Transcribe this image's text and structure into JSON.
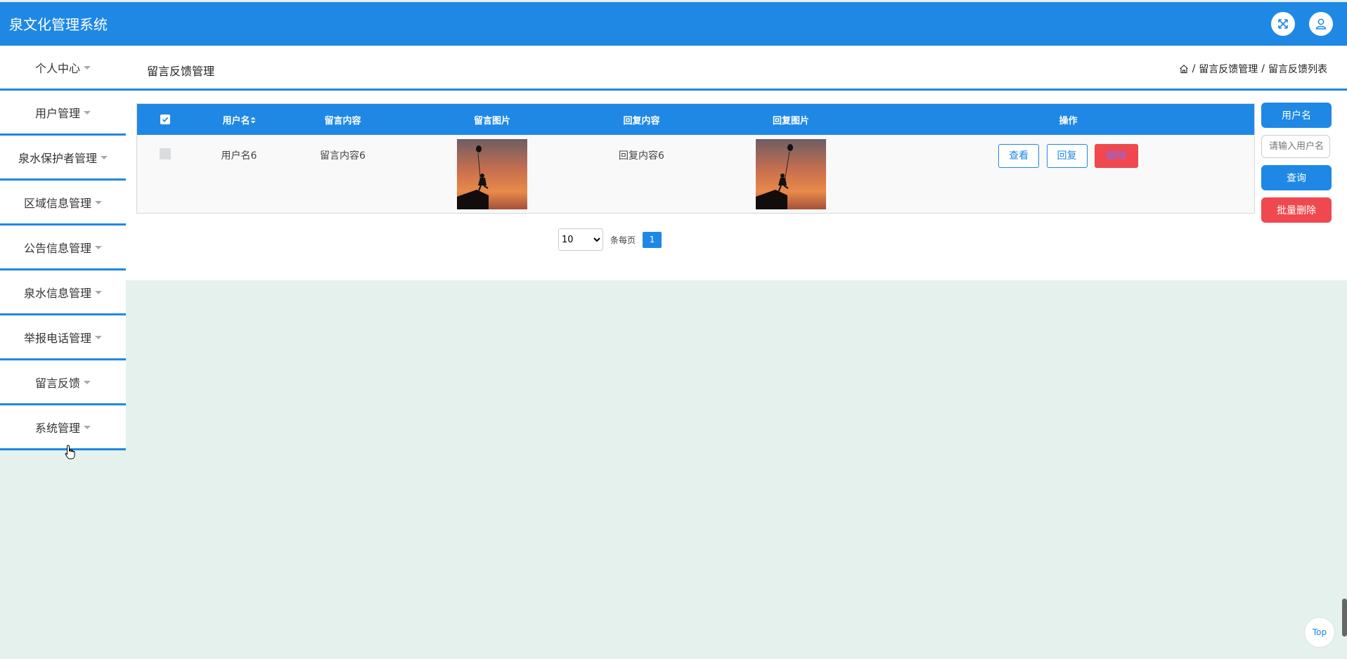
{
  "header": {
    "title": "泉文化管理系统",
    "fullscreen_icon": "expand-icon",
    "user_icon": "user-icon"
  },
  "sidebar": {
    "items": [
      {
        "label": "个人中心"
      },
      {
        "label": "用户管理"
      },
      {
        "label": "泉水保护者管理"
      },
      {
        "label": "区域信息管理"
      },
      {
        "label": "公告信息管理"
      },
      {
        "label": "泉水信息管理"
      },
      {
        "label": "举报电话管理"
      },
      {
        "label": "留言反馈"
      },
      {
        "label": "系统管理"
      }
    ]
  },
  "page": {
    "title": "留言反馈管理",
    "breadcrumb": [
      "留言反馈管理",
      "留言反馈列表"
    ],
    "breadcrumb_separator": "/"
  },
  "table": {
    "columns": [
      "用户名",
      "留言内容",
      "留言图片",
      "回复内容",
      "回复图片",
      "操作"
    ],
    "rows": [
      {
        "username": "用户名6",
        "message": "留言内容6",
        "reply": "回复内容6"
      }
    ],
    "actions": {
      "view": "查看",
      "reply": "回复",
      "delete": "删除"
    }
  },
  "pagination": {
    "page_size": "10",
    "page_size_options": [
      "10"
    ],
    "per_page_label": "条每页",
    "current_page": "1"
  },
  "search": {
    "field_label": "用户名",
    "placeholder": "请输入用户名",
    "query_button": "查询",
    "batch_delete_button": "批量删除"
  },
  "back_to_top": "Top",
  "colors": {
    "primary": "#1f88e5",
    "danger": "#f0484f",
    "background": "#e4f1ec"
  }
}
